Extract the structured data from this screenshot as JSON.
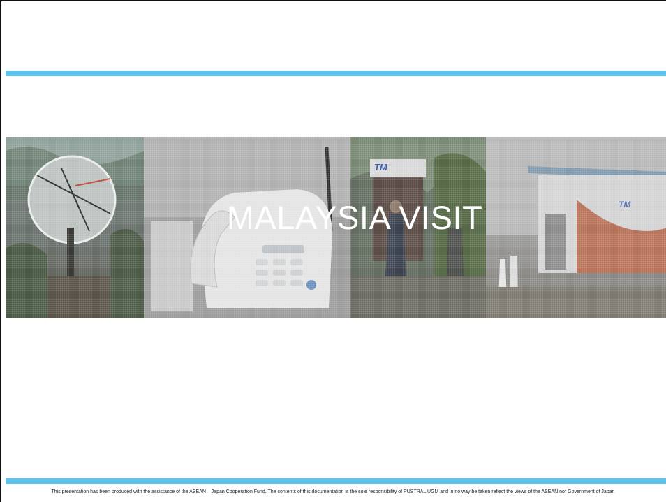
{
  "slide": {
    "title": "MALAYSIA VISIT",
    "footer": "This presentation has been produced with the assistance of the ASEAN – Japan Cooperation Fund. The contents of this documentation is the sole responsibility of PUSTRAL UGM and in no way be taken reflect the views of the ASEAN nor Government of Japan",
    "photo_labels": [
      "TM",
      "TM"
    ]
  },
  "colors": {
    "accent_rule": "#5bc3ee",
    "title_text": "#ffffff",
    "background": "#ffffff"
  }
}
